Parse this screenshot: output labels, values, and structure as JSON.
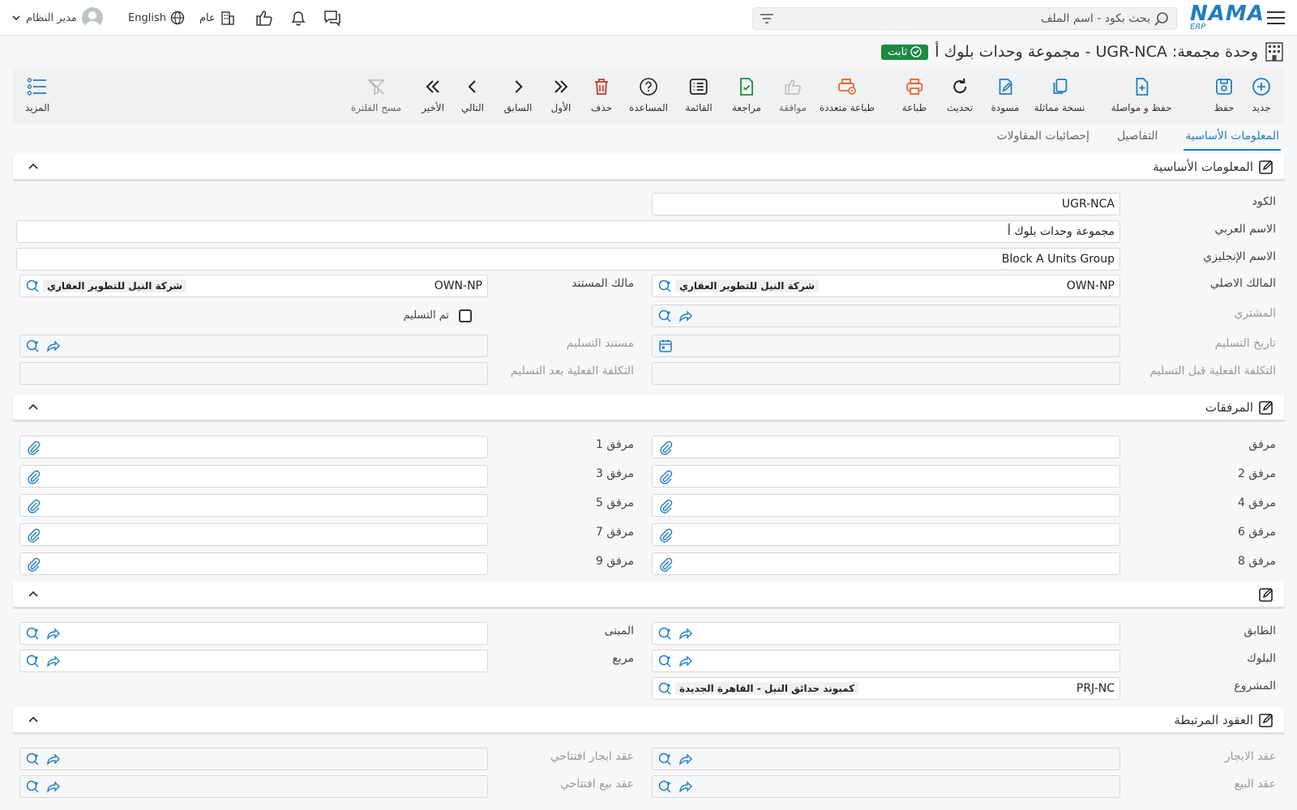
{
  "topbar": {
    "logo_main": "NAMA",
    "logo_sub": "ERP",
    "search_placeholder": "بحث بكود - اسم الملف",
    "user_name": "مدير النظام",
    "language": "English",
    "scope": "عام"
  },
  "title": {
    "text": "وحدة مجمعة: UGR-NCA - مجموعة وحدات بلوك أ",
    "status": "ثابت"
  },
  "toolbar": {
    "new": "جديد",
    "save": "حفظ",
    "save_continue": "حفظ و مواصلة",
    "duplicate": "نسخة مماثلة",
    "draft": "مسودة",
    "refresh": "تحديث",
    "print": "طباعة",
    "multi_print": "طباعة متعددة",
    "approve": "موافقة",
    "review": "مراجعة",
    "list": "القائمة",
    "help": "المساعدة",
    "delete": "حذف",
    "first": "الأول",
    "previous": "السابق",
    "next": "التالي",
    "last": "الأخير",
    "clear_filter": "مسح الفلترة",
    "more": "المزيد"
  },
  "tabs": [
    "المعلومات الأساسية",
    "التفاصيل",
    "إحصائيات المقاولات"
  ],
  "basic": {
    "title": "المعلومات الأساسية",
    "code_label": "الكود",
    "code_value": "UGR-NCA",
    "arabic_name_label": "الاسم العربي",
    "arabic_name_value": "مجموعة وحدات بلوك أ",
    "english_name_label": "الاسم الإنجليزي",
    "english_name_value": "Block A Units Group",
    "original_owner_label": "المالك الاصلي",
    "original_owner_code": "OWN-NP",
    "original_owner_name": "شركة النيل للتطوير العقاري",
    "doc_owner_label": "مالك المستند",
    "doc_owner_code": "OWN-NP",
    "doc_owner_name": "شركة النيل للتطوير العقاري",
    "buyer_label": "المشتري",
    "delivered_label": "تم التسليم",
    "delivery_date_label": "تاريخ التسليم",
    "delivery_doc_label": "مستند التسليم",
    "cost_before_label": "التكلفة الفعلية قبل التسليم",
    "cost_after_label": "التكلفة الفعلية بعد التسليم"
  },
  "attachments": {
    "title": "المرفقات",
    "labels": [
      "مرفق",
      "مرفق 1",
      "مرفق 2",
      "مرفق 3",
      "مرفق 4",
      "مرفق 5",
      "مرفق 6",
      "مرفق 7",
      "مرفق 8",
      "مرفق 9"
    ]
  },
  "location": {
    "floor_label": "الطابق",
    "building_label": "المبنى",
    "block_label": "البلوك",
    "square_label": "مربع",
    "project_label": "المشروع",
    "project_code": "PRJ-NC",
    "project_name": "كمبوند حدائق النيل - القاهرة الجديدة"
  },
  "contracts": {
    "title": "العقود المرتبطة",
    "rent_label": "عقد الايجار",
    "opening_rent_label": "عقد ايجار افتتاحي",
    "sale_label": "عقد البيع",
    "opening_sale_label": "عقد بيع افتتاحي"
  },
  "colors": {
    "accent": "#1f7fc1",
    "print_orange": "#e8652b",
    "delete_red": "#c0392b",
    "review_green": "#1e8a44",
    "status_green": "#1e8a44"
  }
}
